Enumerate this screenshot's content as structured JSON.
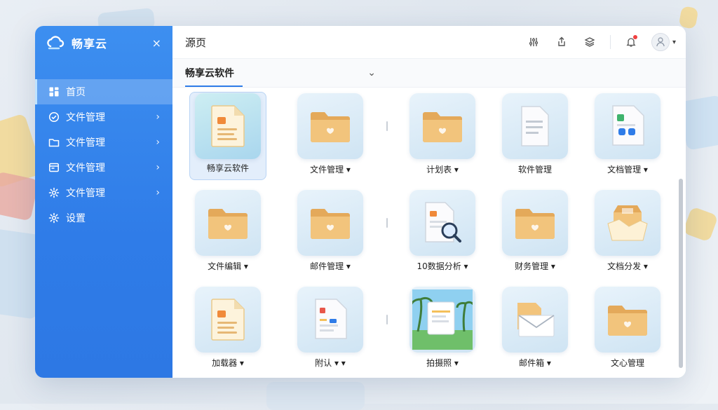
{
  "app": {
    "name": "畅享云",
    "close_symbol": "×"
  },
  "sidebar": {
    "items": [
      {
        "label": "首页",
        "icon": "dashboard-icon",
        "active": true,
        "has_chevron": false
      },
      {
        "label": "文件管理",
        "icon": "check-circle-icon",
        "active": false,
        "has_chevron": true
      },
      {
        "label": "文件管理",
        "icon": "folder-icon",
        "active": false,
        "has_chevron": true
      },
      {
        "label": "文件管理",
        "icon": "window-icon",
        "active": false,
        "has_chevron": true
      },
      {
        "label": "文件管理",
        "icon": "gear-icon",
        "active": false,
        "has_chevron": true
      },
      {
        "label": "设置",
        "icon": "gear-icon",
        "active": false,
        "has_chevron": false
      }
    ],
    "chevron": "›"
  },
  "header": {
    "title": "源页"
  },
  "selector": {
    "label": "畅享云软件",
    "chevron": "⌄"
  },
  "tiles": [
    {
      "label": "畅享云软件",
      "icon": "document-icon",
      "selected": true
    },
    {
      "label": "文件管理 ▾",
      "icon": "folder-icon",
      "selected": false
    },
    {
      "label": "计划表 ▾",
      "icon": "folder-icon",
      "selected": false
    },
    {
      "label": "软件管理",
      "icon": "document-icon",
      "selected": false
    },
    {
      "label": "文档管理 ▾",
      "icon": "document-icon",
      "selected": false
    },
    {
      "label": "文件编辑 ▾",
      "icon": "folder-icon",
      "selected": false
    },
    {
      "label": "邮件管理 ▾",
      "icon": "folder-icon",
      "selected": false
    },
    {
      "label": "10数据分析 ▾",
      "icon": "search-document-icon",
      "selected": false
    },
    {
      "label": "财务管理 ▾",
      "icon": "folder-icon",
      "selected": false
    },
    {
      "label": "文档分发 ▾",
      "icon": "box-icon",
      "selected": false
    },
    {
      "label": "加载器 ▾",
      "icon": "document-icon",
      "selected": false
    },
    {
      "label": "附认 ▾ ▾",
      "icon": "document-icon",
      "selected": false
    },
    {
      "label": "拍摄照 ▾",
      "icon": "photo-icon",
      "selected": false
    },
    {
      "label": "邮件箱 ▾",
      "icon": "mail-icon",
      "selected": false
    },
    {
      "label": "文心管理",
      "icon": "folder-icon",
      "selected": false
    }
  ],
  "colors": {
    "sidebar": "#2f7ce8",
    "accent": "#2f7ce8",
    "folder": "#e9b86a",
    "notify": "#f04040"
  }
}
